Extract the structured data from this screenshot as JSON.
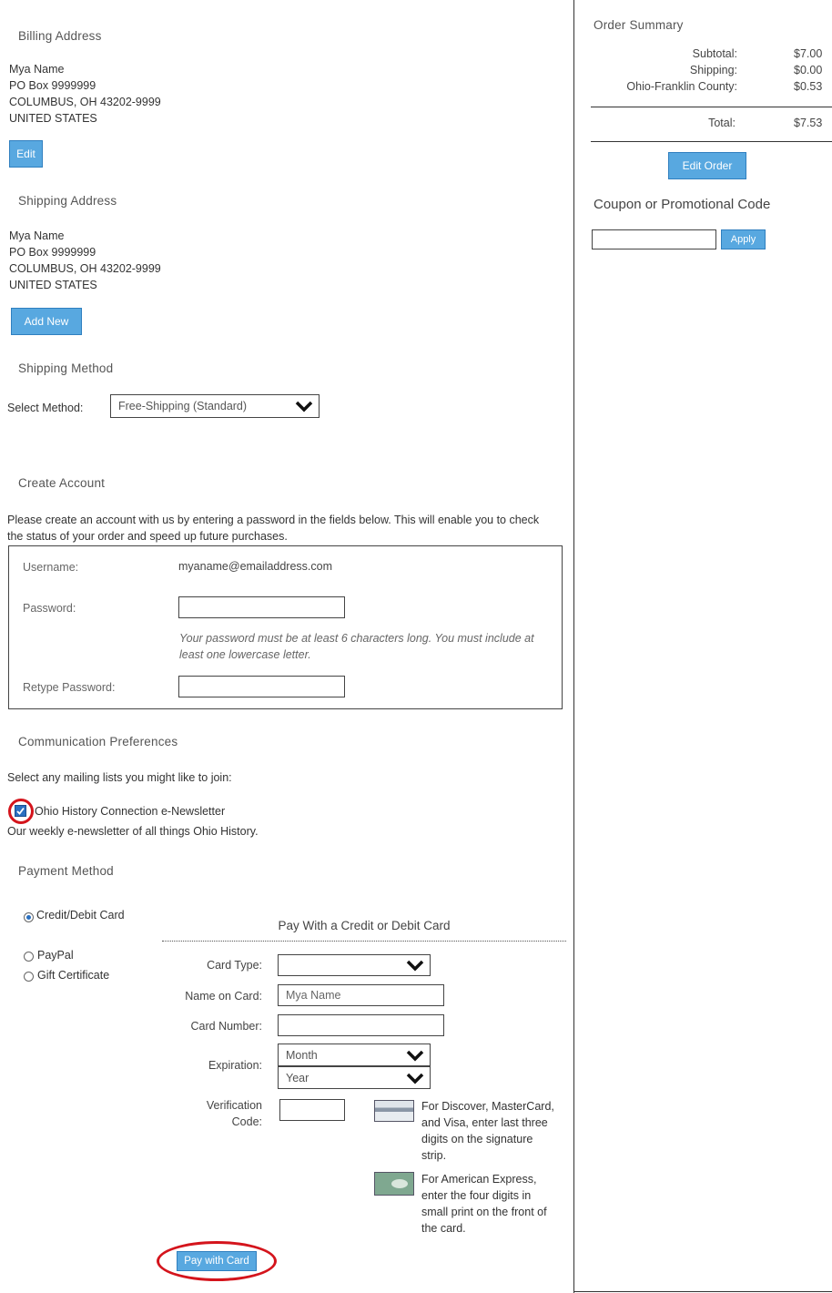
{
  "billing": {
    "heading": "Billing Address",
    "lines": [
      "Mya Name",
      "PO Box 9999999",
      "COLUMBUS, OH 43202-9999",
      "UNITED STATES"
    ],
    "edit_label": "Edit"
  },
  "shipping_address": {
    "heading": "Shipping Address",
    "lines": [
      "Mya Name",
      "PO Box 9999999",
      "COLUMBUS, OH 43202-9999",
      "UNITED STATES"
    ],
    "add_new_label": "Add New"
  },
  "shipping_method": {
    "heading": "Shipping Method",
    "select_label": "Select Method:",
    "selected": "Free-Shipping (Standard)"
  },
  "account": {
    "heading": "Create Account",
    "intro": "Please create an account with us by entering a password in the fields below. This will enable you to check the status of your order and speed up future purchases.",
    "username_label": "Username:",
    "username_value": "myaname@emailaddress.com",
    "password_label": "Password:",
    "password_hint": "Your password must be at least 6 characters long. You must include at least one lowercase letter.",
    "retype_label": "Retype Password:"
  },
  "communication": {
    "heading": "Communication Preferences",
    "intro": "Select any mailing lists you might like to join:",
    "newsletter_label": "Ohio History Connection e-Newsletter",
    "newsletter_desc": "Our weekly e-newsletter of all things Ohio History."
  },
  "payment": {
    "heading": "Payment Method",
    "options": [
      "Credit/Debit Card",
      "PayPal",
      "Gift Certificate"
    ],
    "card_heading": "Pay With a Credit or Debit Card",
    "card_type_label": "Card Type:",
    "name_label": "Name on Card:",
    "name_value": "Mya Name",
    "number_label": "Card Number:",
    "expiration_label": "Expiration:",
    "month_placeholder": "Month",
    "year_placeholder": "Year",
    "verification_label": "Verification Code:",
    "discover_note": "For Discover, MasterCard, and Visa, enter last three digits on the signature strip.",
    "amex_note": "For American Express, enter the four digits in small print on the front of the card.",
    "submit_label": "Pay with Card"
  },
  "summary": {
    "heading": "Order Summary",
    "rows": [
      {
        "label": "Subtotal:",
        "value": "$7.00"
      },
      {
        "label": "Shipping:",
        "value": "$0.00"
      },
      {
        "label": "Ohio-Franklin County:",
        "value": "$0.53"
      }
    ],
    "total_label": "Total:",
    "total_value": "$7.53",
    "edit_order_label": "Edit Order",
    "coupon_heading": "Coupon or Promotional Code",
    "apply_label": "Apply"
  },
  "colors": {
    "button": "#58a8e0",
    "highlight_ring": "#d4141c"
  }
}
